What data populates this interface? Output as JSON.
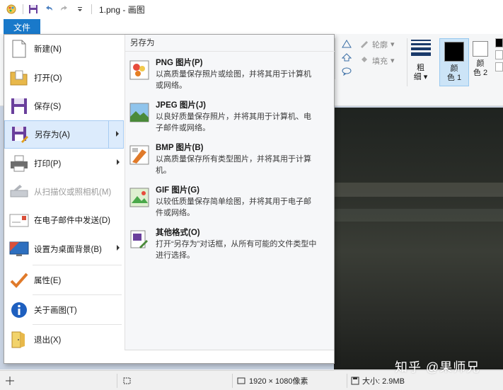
{
  "window": {
    "title": "1.png - 画图"
  },
  "ribbon": {
    "file_tab": "文件",
    "outline_label": "轮廓",
    "fill_label": "填充",
    "size_label_1": "粗",
    "size_label_2": "细",
    "color1_label_1": "颜",
    "color1_label_2": "色 1",
    "color2_label_1": "颜",
    "color2_label_2": "色 2",
    "color1_value": "#000000",
    "color2_value": "#ffffff"
  },
  "file_menu": {
    "items": [
      {
        "label": "新建(N)"
      },
      {
        "label": "打开(O)"
      },
      {
        "label": "保存(S)"
      },
      {
        "label": "另存为(A)"
      },
      {
        "label": "打印(P)"
      },
      {
        "label": "从扫描仪或照相机(M)"
      },
      {
        "label": "在电子邮件中发送(D)"
      },
      {
        "label": "设置为桌面背景(B)"
      },
      {
        "label": "属性(E)"
      },
      {
        "label": "关于画图(T)"
      },
      {
        "label": "退出(X)"
      }
    ],
    "save_as_pane": {
      "header": "另存为",
      "options": [
        {
          "title": "PNG 图片(P)",
          "desc": "以高质量保存照片或绘图，并将其用于计算机或网络。"
        },
        {
          "title": "JPEG 图片(J)",
          "desc": "以良好质量保存照片，并将其用于计算机、电子邮件或网络。"
        },
        {
          "title": "BMP 图片(B)",
          "desc": "以高质量保存所有类型图片，并将其用于计算机。"
        },
        {
          "title": "GIF 图片(G)",
          "desc": "以较低质量保存简单绘图，并将其用于电子邮件或网络。"
        },
        {
          "title": "其他格式(O)",
          "desc": "打开“另存为”对话框，从所有可能的文件类型中进行选择。"
        }
      ]
    }
  },
  "statusbar": {
    "dimensions": "1920 × 1080像素",
    "size": "大小: 2.9MB"
  },
  "watermark": "知乎 @果师兄",
  "colors": {
    "accent": "#1979ca",
    "menu_highlight": "#dcebfc"
  }
}
